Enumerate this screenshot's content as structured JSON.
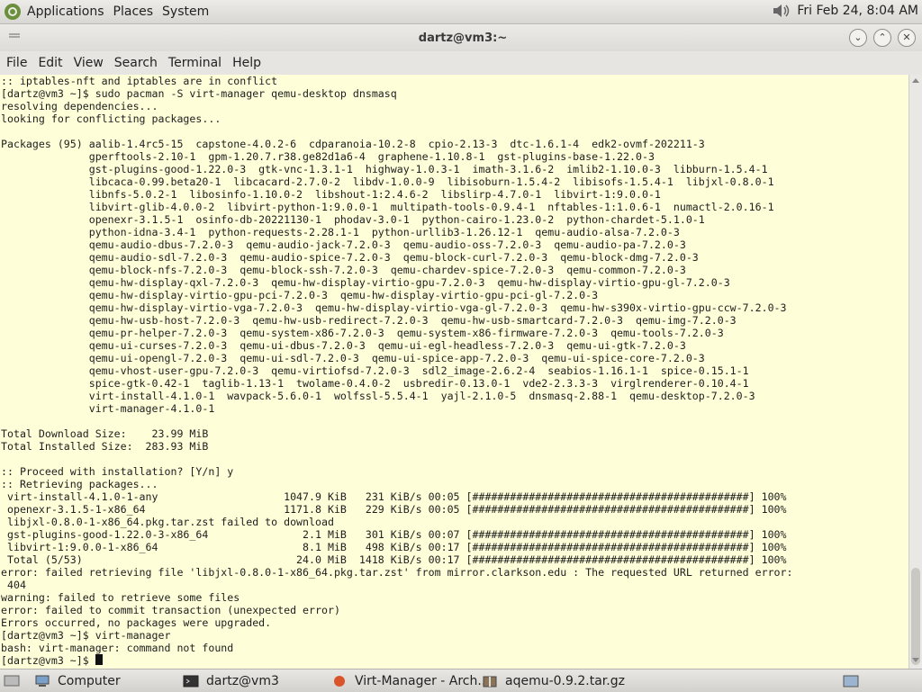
{
  "top_panel": {
    "menus": [
      "Applications",
      "Places",
      "System"
    ],
    "clock": "Fri Feb 24,  8:04 AM"
  },
  "window": {
    "title": "dartz@vm3:~"
  },
  "menubar": [
    "File",
    "Edit",
    "View",
    "Search",
    "Terminal",
    "Help"
  ],
  "terminal": {
    "lines": [
      ":: iptables-nft and iptables are in conflict",
      "[dartz@vm3 ~]$ sudo pacman -S virt-manager qemu-desktop dnsmasq",
      "resolving dependencies...",
      "looking for conflicting packages...",
      "",
      "Packages (95) aalib-1.4rc5-15  capstone-4.0.2-6  cdparanoia-10.2-8  cpio-2.13-3  dtc-1.6.1-4  edk2-ovmf-202211-3",
      "              gperftools-2.10-1  gpm-1.20.7.r38.ge82d1a6-4  graphene-1.10.8-1  gst-plugins-base-1.22.0-3",
      "              gst-plugins-good-1.22.0-3  gtk-vnc-1.3.1-1  highway-1.0.3-1  imath-3.1.6-2  imlib2-1.10.0-3  libburn-1.5.4-1",
      "              libcaca-0.99.beta20-1  libcacard-2.7.0-2  libdv-1.0.0-9  libisoburn-1.5.4-2  libisofs-1.5.4-1  libjxl-0.8.0-1",
      "              libnfs-5.0.2-1  libosinfo-1.10.0-2  libshout-1:2.4.6-2  libslirp-4.7.0-1  libvirt-1:9.0.0-1",
      "              libvirt-glib-4.0.0-2  libvirt-python-1:9.0.0-1  multipath-tools-0.9.4-1  nftables-1:1.0.6-1  numactl-2.0.16-1",
      "              openexr-3.1.5-1  osinfo-db-20221130-1  phodav-3.0-1  python-cairo-1.23.0-2  python-chardet-5.1.0-1",
      "              python-idna-3.4-1  python-requests-2.28.1-1  python-urllib3-1.26.12-1  qemu-audio-alsa-7.2.0-3",
      "              qemu-audio-dbus-7.2.0-3  qemu-audio-jack-7.2.0-3  qemu-audio-oss-7.2.0-3  qemu-audio-pa-7.2.0-3",
      "              qemu-audio-sdl-7.2.0-3  qemu-audio-spice-7.2.0-3  qemu-block-curl-7.2.0-3  qemu-block-dmg-7.2.0-3",
      "              qemu-block-nfs-7.2.0-3  qemu-block-ssh-7.2.0-3  qemu-chardev-spice-7.2.0-3  qemu-common-7.2.0-3",
      "              qemu-hw-display-qxl-7.2.0-3  qemu-hw-display-virtio-gpu-7.2.0-3  qemu-hw-display-virtio-gpu-gl-7.2.0-3",
      "              qemu-hw-display-virtio-gpu-pci-7.2.0-3  qemu-hw-display-virtio-gpu-pci-gl-7.2.0-3",
      "              qemu-hw-display-virtio-vga-7.2.0-3  qemu-hw-display-virtio-vga-gl-7.2.0-3  qemu-hw-s390x-virtio-gpu-ccw-7.2.0-3",
      "              qemu-hw-usb-host-7.2.0-3  qemu-hw-usb-redirect-7.2.0-3  qemu-hw-usb-smartcard-7.2.0-3  qemu-img-7.2.0-3",
      "              qemu-pr-helper-7.2.0-3  qemu-system-x86-7.2.0-3  qemu-system-x86-firmware-7.2.0-3  qemu-tools-7.2.0-3",
      "              qemu-ui-curses-7.2.0-3  qemu-ui-dbus-7.2.0-3  qemu-ui-egl-headless-7.2.0-3  qemu-ui-gtk-7.2.0-3",
      "              qemu-ui-opengl-7.2.0-3  qemu-ui-sdl-7.2.0-3  qemu-ui-spice-app-7.2.0-3  qemu-ui-spice-core-7.2.0-3",
      "              qemu-vhost-user-gpu-7.2.0-3  qemu-virtiofsd-7.2.0-3  sdl2_image-2.6.2-4  seabios-1.16.1-1  spice-0.15.1-1",
      "              spice-gtk-0.42-1  taglib-1.13-1  twolame-0.4.0-2  usbredir-0.13.0-1  vde2-2.3.3-3  virglrenderer-0.10.4-1",
      "              virt-install-4.1.0-1  wavpack-5.6.0-1  wolfssl-5.5.4-1  yajl-2.1.0-5  dnsmasq-2.88-1  qemu-desktop-7.2.0-3",
      "              virt-manager-4.1.0-1",
      "",
      "Total Download Size:    23.99 MiB",
      "Total Installed Size:  283.93 MiB",
      "",
      ":: Proceed with installation? [Y/n] y",
      ":: Retrieving packages...",
      " virt-install-4.1.0-1-any                    1047.9 KiB   231 KiB/s 00:05 [############################################] 100%",
      " openexr-3.1.5-1-x86_64                      1171.8 KiB   229 KiB/s 00:05 [############################################] 100%",
      " libjxl-0.8.0-1-x86_64.pkg.tar.zst failed to download",
      " gst-plugins-good-1.22.0-3-x86_64               2.1 MiB   301 KiB/s 00:07 [############################################] 100%",
      " libvirt-1:9.0.0-1-x86_64                       8.1 MiB   498 KiB/s 00:17 [############################################] 100%",
      " Total (5/53)                                  24.0 MiB  1418 KiB/s 00:17 [############################################] 100%",
      "error: failed retrieving file 'libjxl-0.8.0-1-x86_64.pkg.tar.zst' from mirror.clarkson.edu : The requested URL returned error:",
      " 404",
      "warning: failed to retrieve some files",
      "error: failed to commit transaction (unexpected error)",
      "Errors occurred, no packages were upgraded.",
      "[dartz@vm3 ~]$ virt-manager",
      "bash: virt-manager: command not found"
    ],
    "prompt": "[dartz@vm3 ~]$ "
  },
  "taskbar": {
    "items": [
      "Computer",
      "dartz@vm3",
      "Virt-Manager - Arch...",
      "aqemu-0.9.2.tar.gz"
    ]
  },
  "icons": {
    "logo": "gnome-foot-icon",
    "volume": "speaker-icon",
    "window_buttons": [
      "minimize-icon",
      "maximize-icon",
      "close-icon"
    ]
  }
}
